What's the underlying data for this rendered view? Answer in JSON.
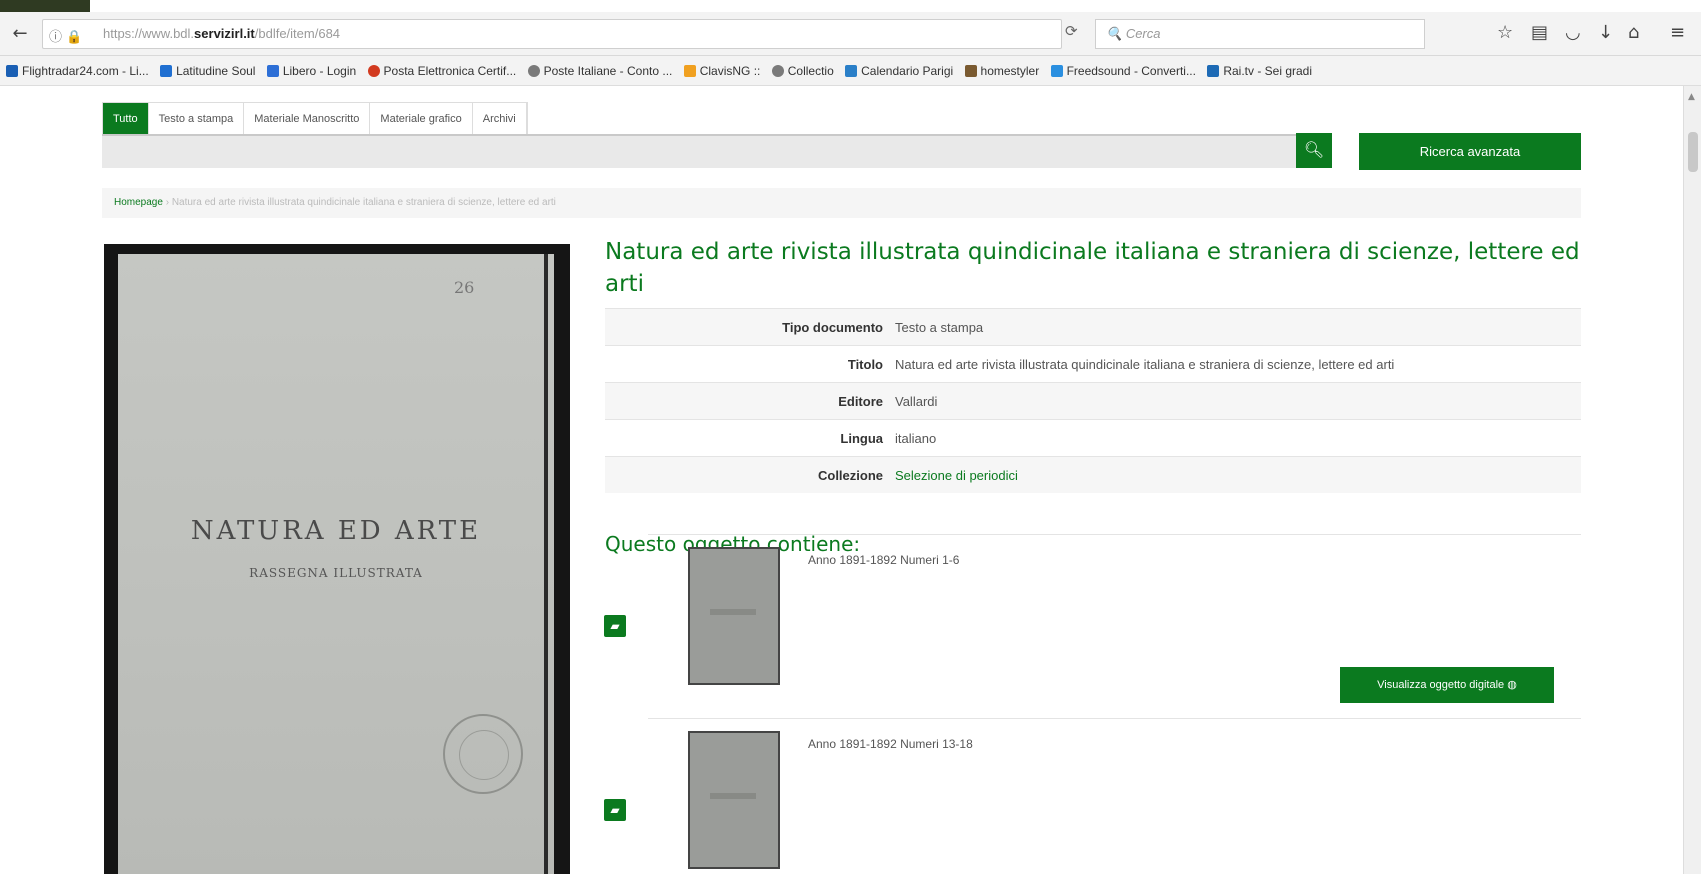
{
  "browser": {
    "url_prefix": "https://www.bdl.",
    "url_domain": "servizirl.it",
    "url_path": "/bdlfe/item/684",
    "search_placeholder": "Cerca"
  },
  "bookmarks": [
    {
      "label": "Flightradar24.com - Li...",
      "color": "#1a5fb4"
    },
    {
      "label": "Latitudine Soul",
      "color": "#1f6fd1"
    },
    {
      "label": "Libero - Login",
      "color": "#2d6fd6"
    },
    {
      "label": "Posta Elettronica Certif...",
      "color": "#d23a1f"
    },
    {
      "label": "Poste Italiane - Conto ...",
      "color": "#7a7a7a"
    },
    {
      "label": "ClavisNG ::",
      "color": "#f0a020"
    },
    {
      "label": "Collectio",
      "color": "#7a7a7a"
    },
    {
      "label": "Calendario Parigi",
      "color": "#2a7fc8"
    },
    {
      "label": "homestyler",
      "color": "#7a5a30"
    },
    {
      "label": "Freedsound - Converti...",
      "color": "#2a8fe0"
    },
    {
      "label": "Rai.tv - Sei gradi",
      "color": "#1d6ab5"
    }
  ],
  "tabs": [
    "Tutto",
    "Testo a stampa",
    "Materiale Manoscritto",
    "Materiale grafico",
    "Archivi"
  ],
  "search": {
    "advanced_label": "Ricerca avanzata"
  },
  "breadcrumb": {
    "home": "Homepage",
    "current": "Natura ed arte rivista illustrata quindicinale italiana e straniera di scienze, lettere ed arti"
  },
  "cover": {
    "number": "26",
    "title": "NATURA ED ARTE",
    "subtitle": "RASSEGNA ILLUSTRATA"
  },
  "item": {
    "title": "Natura ed arte rivista illustrata quindicinale italiana e straniera di scienze, lettere ed arti",
    "metadata": [
      {
        "key": "Tipo documento",
        "value": "Testo a stampa"
      },
      {
        "key": "Titolo",
        "value": "Natura ed arte rivista illustrata quindicinale italiana e straniera di scienze, lettere ed arti"
      },
      {
        "key": "Editore",
        "value": "Vallardi"
      },
      {
        "key": "Lingua",
        "value": "italiano"
      },
      {
        "key": "Collezione",
        "value": "Selezione di periodici"
      }
    ],
    "contains_heading": "Questo oggetto contiene:",
    "children": [
      {
        "label": "Anno 1891-1892 Numeri 1-6",
        "button": "Visualizza oggetto digitale"
      },
      {
        "label": "Anno 1891-1892 Numeri 13-18"
      }
    ]
  },
  "colors": {
    "accent": "#0b7a1f"
  }
}
